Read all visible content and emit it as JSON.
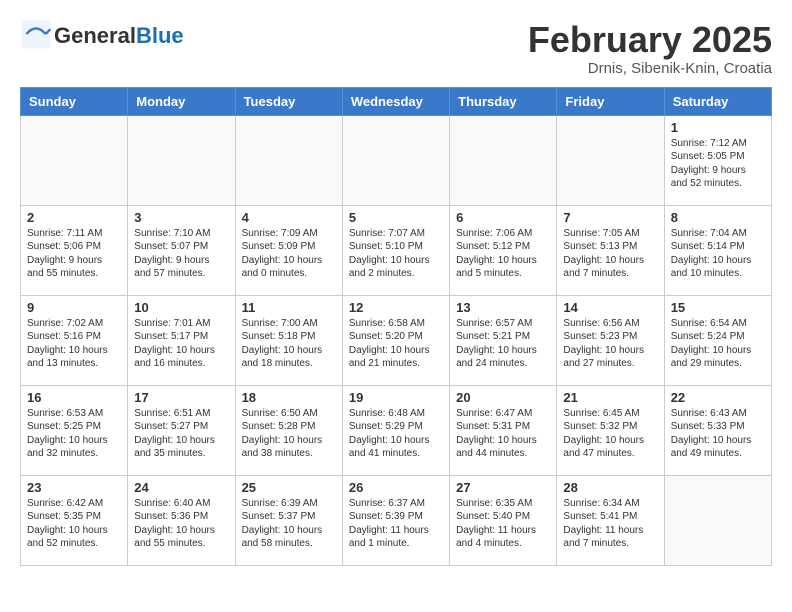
{
  "logo": {
    "general": "General",
    "blue": "Blue"
  },
  "title": {
    "month": "February 2025",
    "location": "Drnis, Sibenik-Knin, Croatia"
  },
  "days_of_week": [
    "Sunday",
    "Monday",
    "Tuesday",
    "Wednesday",
    "Thursday",
    "Friday",
    "Saturday"
  ],
  "weeks": [
    [
      {
        "day": "",
        "info": ""
      },
      {
        "day": "",
        "info": ""
      },
      {
        "day": "",
        "info": ""
      },
      {
        "day": "",
        "info": ""
      },
      {
        "day": "",
        "info": ""
      },
      {
        "day": "",
        "info": ""
      },
      {
        "day": "1",
        "info": "Sunrise: 7:12 AM\nSunset: 5:05 PM\nDaylight: 9 hours and 52 minutes."
      }
    ],
    [
      {
        "day": "2",
        "info": "Sunrise: 7:11 AM\nSunset: 5:06 PM\nDaylight: 9 hours and 55 minutes."
      },
      {
        "day": "3",
        "info": "Sunrise: 7:10 AM\nSunset: 5:07 PM\nDaylight: 9 hours and 57 minutes."
      },
      {
        "day": "4",
        "info": "Sunrise: 7:09 AM\nSunset: 5:09 PM\nDaylight: 10 hours and 0 minutes."
      },
      {
        "day": "5",
        "info": "Sunrise: 7:07 AM\nSunset: 5:10 PM\nDaylight: 10 hours and 2 minutes."
      },
      {
        "day": "6",
        "info": "Sunrise: 7:06 AM\nSunset: 5:12 PM\nDaylight: 10 hours and 5 minutes."
      },
      {
        "day": "7",
        "info": "Sunrise: 7:05 AM\nSunset: 5:13 PM\nDaylight: 10 hours and 7 minutes."
      },
      {
        "day": "8",
        "info": "Sunrise: 7:04 AM\nSunset: 5:14 PM\nDaylight: 10 hours and 10 minutes."
      }
    ],
    [
      {
        "day": "9",
        "info": "Sunrise: 7:02 AM\nSunset: 5:16 PM\nDaylight: 10 hours and 13 minutes."
      },
      {
        "day": "10",
        "info": "Sunrise: 7:01 AM\nSunset: 5:17 PM\nDaylight: 10 hours and 16 minutes."
      },
      {
        "day": "11",
        "info": "Sunrise: 7:00 AM\nSunset: 5:18 PM\nDaylight: 10 hours and 18 minutes."
      },
      {
        "day": "12",
        "info": "Sunrise: 6:58 AM\nSunset: 5:20 PM\nDaylight: 10 hours and 21 minutes."
      },
      {
        "day": "13",
        "info": "Sunrise: 6:57 AM\nSunset: 5:21 PM\nDaylight: 10 hours and 24 minutes."
      },
      {
        "day": "14",
        "info": "Sunrise: 6:56 AM\nSunset: 5:23 PM\nDaylight: 10 hours and 27 minutes."
      },
      {
        "day": "15",
        "info": "Sunrise: 6:54 AM\nSunset: 5:24 PM\nDaylight: 10 hours and 29 minutes."
      }
    ],
    [
      {
        "day": "16",
        "info": "Sunrise: 6:53 AM\nSunset: 5:25 PM\nDaylight: 10 hours and 32 minutes."
      },
      {
        "day": "17",
        "info": "Sunrise: 6:51 AM\nSunset: 5:27 PM\nDaylight: 10 hours and 35 minutes."
      },
      {
        "day": "18",
        "info": "Sunrise: 6:50 AM\nSunset: 5:28 PM\nDaylight: 10 hours and 38 minutes."
      },
      {
        "day": "19",
        "info": "Sunrise: 6:48 AM\nSunset: 5:29 PM\nDaylight: 10 hours and 41 minutes."
      },
      {
        "day": "20",
        "info": "Sunrise: 6:47 AM\nSunset: 5:31 PM\nDaylight: 10 hours and 44 minutes."
      },
      {
        "day": "21",
        "info": "Sunrise: 6:45 AM\nSunset: 5:32 PM\nDaylight: 10 hours and 47 minutes."
      },
      {
        "day": "22",
        "info": "Sunrise: 6:43 AM\nSunset: 5:33 PM\nDaylight: 10 hours and 49 minutes."
      }
    ],
    [
      {
        "day": "23",
        "info": "Sunrise: 6:42 AM\nSunset: 5:35 PM\nDaylight: 10 hours and 52 minutes."
      },
      {
        "day": "24",
        "info": "Sunrise: 6:40 AM\nSunset: 5:36 PM\nDaylight: 10 hours and 55 minutes."
      },
      {
        "day": "25",
        "info": "Sunrise: 6:39 AM\nSunset: 5:37 PM\nDaylight: 10 hours and 58 minutes."
      },
      {
        "day": "26",
        "info": "Sunrise: 6:37 AM\nSunset: 5:39 PM\nDaylight: 11 hours and 1 minute."
      },
      {
        "day": "27",
        "info": "Sunrise: 6:35 AM\nSunset: 5:40 PM\nDaylight: 11 hours and 4 minutes."
      },
      {
        "day": "28",
        "info": "Sunrise: 6:34 AM\nSunset: 5:41 PM\nDaylight: 11 hours and 7 minutes."
      },
      {
        "day": "",
        "info": ""
      }
    ]
  ]
}
